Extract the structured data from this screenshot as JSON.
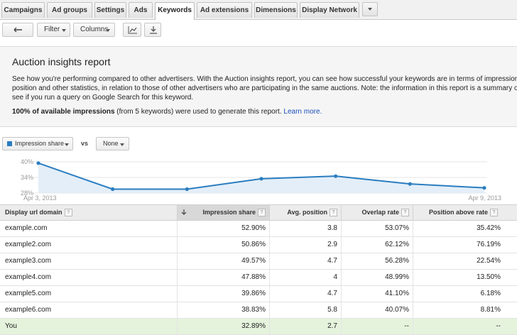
{
  "tabs": [
    {
      "label": "Campaigns",
      "active": false
    },
    {
      "label": "Ad groups",
      "active": false
    },
    {
      "label": "Settings",
      "active": false
    },
    {
      "label": "Ads",
      "active": false
    },
    {
      "label": "Keywords",
      "active": true
    },
    {
      "label": "Ad extensions",
      "active": false
    },
    {
      "label": "Dimensions",
      "active": false
    },
    {
      "label": "Display Network",
      "active": false
    }
  ],
  "toolbar": {
    "back_icon": "back-arrow-icon",
    "filter_label": "Filter",
    "columns_label": "Columns",
    "graph_icon": "line-graph-icon",
    "download_icon": "download-icon"
  },
  "report": {
    "title": "Auction insights report",
    "description_lines": [
      "See how you're performing compared to other advertisers. With the Auction insights report, you can see how successful your keywords are in terms of impression share,",
      "position and other statistics, in relation to those of other advertisers who are participating in the same auctions. Note: the information in this report is a summary of",
      "see if you run a query on Google Search for this keyword."
    ],
    "summary_bold": "100% of available impressions",
    "summary_rest": " (from 5 keywords) were used to generate this report. ",
    "learn_more": "Learn more."
  },
  "chart_controls": {
    "metric_label": "Impression share",
    "vs_label": "vs",
    "compare_label": "None",
    "accent_color": "#2a7dc0"
  },
  "chart_data": {
    "type": "area",
    "series": [
      {
        "values": [
          39.5,
          29.5,
          29.5,
          33.5,
          34.5,
          31.5,
          30.0
        ]
      }
    ],
    "y_ticks": [
      "40%",
      "34%",
      "28%"
    ],
    "ylim": [
      28,
      40
    ],
    "x_start_label": "Apr 3, 2013",
    "x_end_label": "Apr 9, 2013",
    "grid": true,
    "line_color": "#2a7dc0",
    "fill_color": "#e3eef8"
  },
  "table": {
    "columns": [
      "Display url domain",
      "Impression share",
      "Avg. position",
      "Overlap rate",
      "Position above rate"
    ],
    "sort_icon": "sort-arrow-icon",
    "rows": [
      {
        "domain": "example.com",
        "impression_share": "52.90%",
        "avg_position": "3.8",
        "overlap_rate": "53.07%",
        "position_above_rate": "35.42%"
      },
      {
        "domain": "example2.com",
        "impression_share": "50.86%",
        "avg_position": "2.9",
        "overlap_rate": "62.12%",
        "position_above_rate": "76.19%"
      },
      {
        "domain": "example3.com",
        "impression_share": "49.57%",
        "avg_position": "4.7",
        "overlap_rate": "56.28%",
        "position_above_rate": "22.54%"
      },
      {
        "domain": "example4.com",
        "impression_share": "47.88%",
        "avg_position": "4",
        "overlap_rate": "48.99%",
        "position_above_rate": "13.50%"
      },
      {
        "domain": "example5.com",
        "impression_share": "39.86%",
        "avg_position": "4.7",
        "overlap_rate": "41.10%",
        "position_above_rate": "6.18%"
      },
      {
        "domain": "example6.com",
        "impression_share": "38.83%",
        "avg_position": "5.8",
        "overlap_rate": "40.07%",
        "position_above_rate": "8.81%"
      }
    ],
    "you_row": {
      "domain": "You",
      "impression_share": "32.89%",
      "avg_position": "2.7",
      "overlap_rate": "--",
      "position_above_rate": "--"
    }
  }
}
